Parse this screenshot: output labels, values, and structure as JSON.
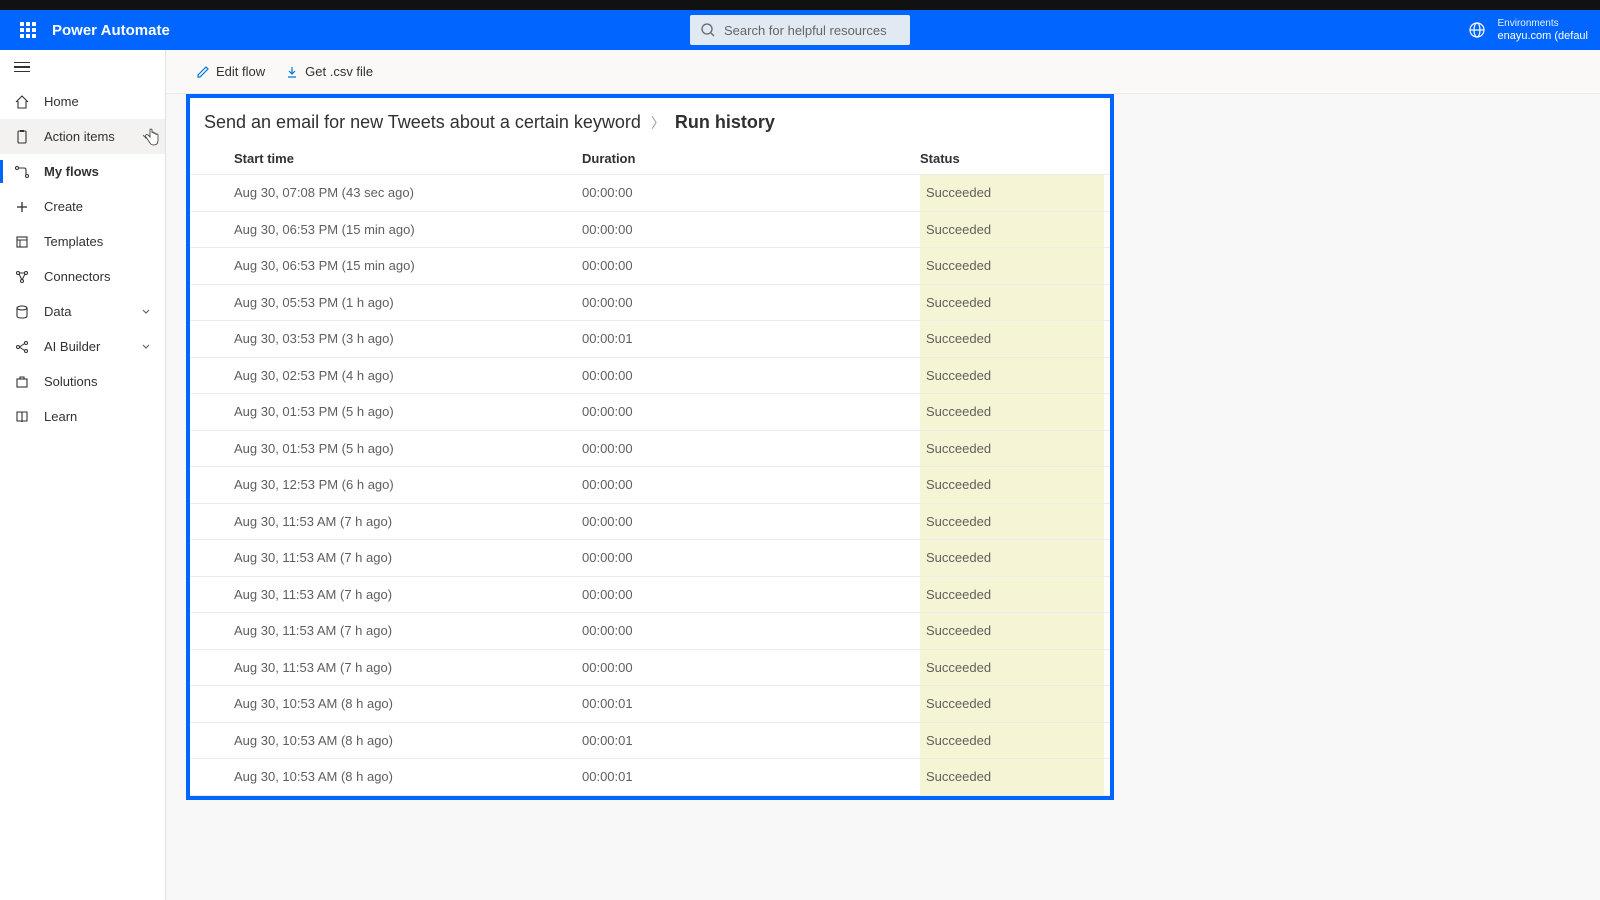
{
  "header": {
    "brand": "Power Automate",
    "search_placeholder": "Search for helpful resources",
    "env_label": "Environments",
    "env_value": "enayu.com (defaul"
  },
  "sidebar": {
    "items": [
      {
        "id": "home",
        "label": "Home"
      },
      {
        "id": "action-items",
        "label": "Action items",
        "chevron": true,
        "hovered": true
      },
      {
        "id": "my-flows",
        "label": "My flows",
        "active": true
      },
      {
        "id": "create",
        "label": "Create"
      },
      {
        "id": "templates",
        "label": "Templates"
      },
      {
        "id": "connectors",
        "label": "Connectors"
      },
      {
        "id": "data",
        "label": "Data",
        "chevron": true
      },
      {
        "id": "ai-builder",
        "label": "AI Builder",
        "chevron": true
      },
      {
        "id": "solutions",
        "label": "Solutions"
      },
      {
        "id": "learn",
        "label": "Learn"
      }
    ]
  },
  "toolbar": {
    "edit_label": "Edit flow",
    "csv_label": "Get .csv file"
  },
  "breadcrumb": {
    "flow_name": "Send an email for new Tweets about a certain keyword",
    "current": "Run history"
  },
  "table": {
    "headers": {
      "start": "Start time",
      "duration": "Duration",
      "status": "Status"
    },
    "rows": [
      {
        "start": "Aug 30, 07:08 PM (43 sec ago)",
        "duration": "00:00:00",
        "status": "Succeeded"
      },
      {
        "start": "Aug 30, 06:53 PM (15 min ago)",
        "duration": "00:00:00",
        "status": "Succeeded"
      },
      {
        "start": "Aug 30, 06:53 PM (15 min ago)",
        "duration": "00:00:00",
        "status": "Succeeded"
      },
      {
        "start": "Aug 30, 05:53 PM (1 h ago)",
        "duration": "00:00:00",
        "status": "Succeeded"
      },
      {
        "start": "Aug 30, 03:53 PM (3 h ago)",
        "duration": "00:00:01",
        "status": "Succeeded"
      },
      {
        "start": "Aug 30, 02:53 PM (4 h ago)",
        "duration": "00:00:00",
        "status": "Succeeded"
      },
      {
        "start": "Aug 30, 01:53 PM (5 h ago)",
        "duration": "00:00:00",
        "status": "Succeeded"
      },
      {
        "start": "Aug 30, 01:53 PM (5 h ago)",
        "duration": "00:00:00",
        "status": "Succeeded"
      },
      {
        "start": "Aug 30, 12:53 PM (6 h ago)",
        "duration": "00:00:00",
        "status": "Succeeded"
      },
      {
        "start": "Aug 30, 11:53 AM (7 h ago)",
        "duration": "00:00:00",
        "status": "Succeeded"
      },
      {
        "start": "Aug 30, 11:53 AM (7 h ago)",
        "duration": "00:00:00",
        "status": "Succeeded"
      },
      {
        "start": "Aug 30, 11:53 AM (7 h ago)",
        "duration": "00:00:00",
        "status": "Succeeded"
      },
      {
        "start": "Aug 30, 11:53 AM (7 h ago)",
        "duration": "00:00:00",
        "status": "Succeeded"
      },
      {
        "start": "Aug 30, 11:53 AM (7 h ago)",
        "duration": "00:00:00",
        "status": "Succeeded"
      },
      {
        "start": "Aug 30, 10:53 AM (8 h ago)",
        "duration": "00:00:01",
        "status": "Succeeded"
      },
      {
        "start": "Aug 30, 10:53 AM (8 h ago)",
        "duration": "00:00:01",
        "status": "Succeeded"
      },
      {
        "start": "Aug 30, 10:53 AM (8 h ago)",
        "duration": "00:00:01",
        "status": "Succeeded"
      }
    ]
  }
}
